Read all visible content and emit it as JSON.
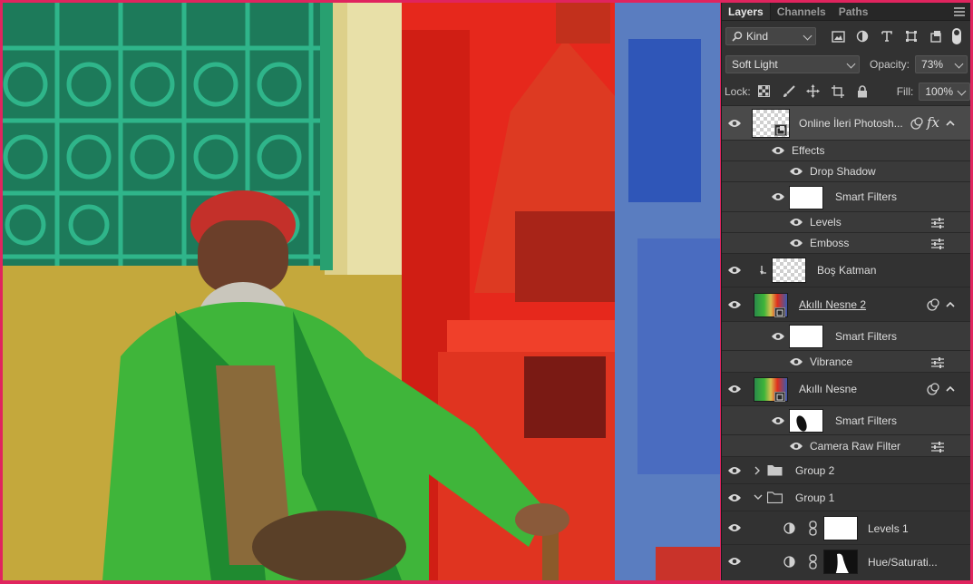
{
  "panel": {
    "tabs": [
      "Layers",
      "Channels",
      "Paths"
    ],
    "kind_filter": "Kind",
    "blend_mode": "Soft Light",
    "opacity_label": "Opacity:",
    "opacity_value": "73%",
    "lock_label": "Lock:",
    "fill_label": "Fill:",
    "fill_value": "100%"
  },
  "layers": [
    {
      "name": "Online İleri Photosh...",
      "fx": "fx"
    },
    {
      "name": "Effects"
    },
    {
      "name": "Drop Shadow"
    },
    {
      "name": "Smart Filters"
    },
    {
      "name": "Levels"
    },
    {
      "name": "Emboss"
    },
    {
      "name": "Boş Katman"
    },
    {
      "name": "Akıllı Nesne 2"
    },
    {
      "name": "Smart Filters"
    },
    {
      "name": "Vibrance"
    },
    {
      "name": "Akıllı Nesne"
    },
    {
      "name": "Smart Filters"
    },
    {
      "name": "Camera Raw Filter"
    },
    {
      "name": "Group 2"
    },
    {
      "name": "Group 1"
    },
    {
      "name": "Levels 1"
    },
    {
      "name": "Hue/Saturati..."
    }
  ],
  "icons": [
    "eye-icon",
    "search-icon",
    "image-filter-icon",
    "adjustment-filter-icon",
    "type-filter-icon",
    "shape-filter-icon",
    "smart-object-filter-icon",
    "lock-transparent-icon",
    "lock-brush-icon",
    "lock-move-icon",
    "lock-artboard-icon",
    "lock-all-icon",
    "filter-options-icon",
    "folder-icon",
    "link-icon",
    "smart-object-badge-icon",
    "chevron-up-icon"
  ]
}
